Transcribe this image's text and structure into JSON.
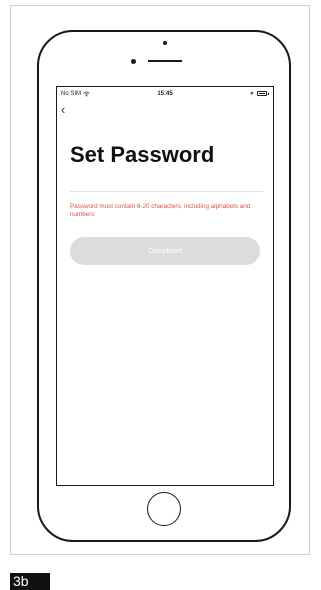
{
  "status_bar": {
    "carrier": "No SIM",
    "time": "15:45",
    "wifi_icon": "wifi-icon",
    "location_icon": "location-arrow-icon",
    "battery_icon": "battery-icon"
  },
  "nav": {
    "back_icon": "chevron-left-icon",
    "back_glyph": "‹"
  },
  "page": {
    "title": "Set Password",
    "password_placeholder": "",
    "hint": "Password must contain 6-20 characters, including alphabets and numbers",
    "hint_color": "#d9534f",
    "submit_label": "Completed",
    "submit_color": "#dcdcdc"
  },
  "step_label": "3b"
}
